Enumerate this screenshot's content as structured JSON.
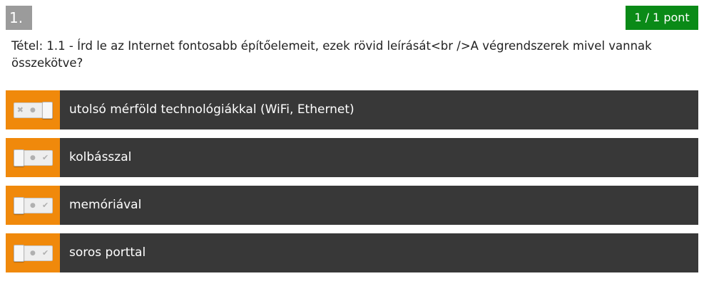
{
  "question": {
    "number": "1.",
    "score": "1 / 1 pont",
    "text": "Tétel: 1.1 - Írd le az Internet fontosabb építőelemeit, ezek rövid leírását<br />A végrendszerek mivel vannak összekötve?"
  },
  "toggle_icons": {
    "wrong": "✖",
    "neutral": "●",
    "right": "✔"
  },
  "answers": [
    {
      "text": "utolsó mérföld technológiákkal (WiFi, Ethernet)",
      "state": "right"
    },
    {
      "text": "kolbásszal",
      "state": "wrong"
    },
    {
      "text": "memóriával",
      "state": "wrong"
    },
    {
      "text": "soros porttal",
      "state": "wrong"
    }
  ],
  "colors": {
    "question_number_bg": "#9b9b9b",
    "score_bg": "#0a8a17",
    "toggle_area_bg": "#f0890b",
    "answer_bg": "#383838"
  }
}
